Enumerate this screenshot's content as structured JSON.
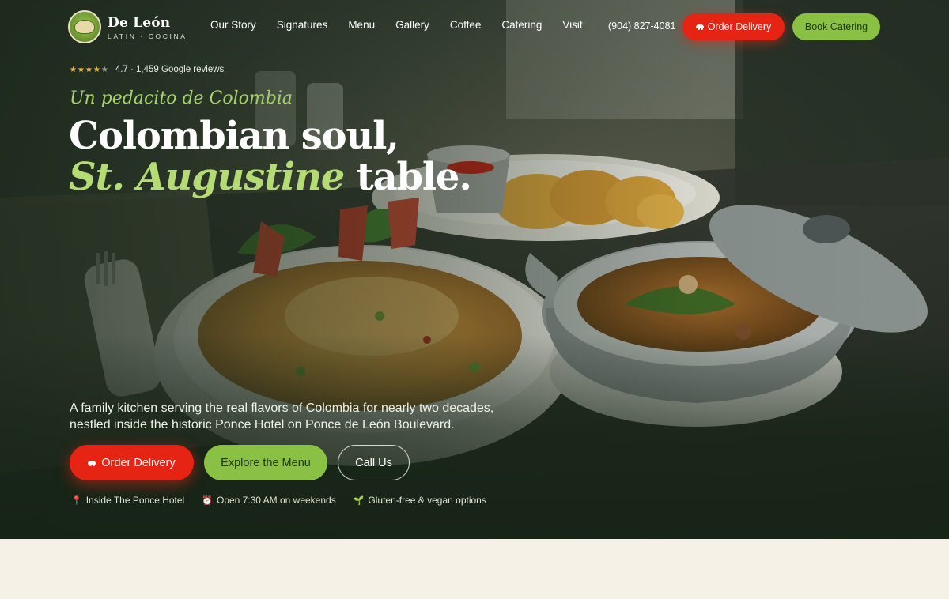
{
  "brand": {
    "name": "De León",
    "subtitle": "LATIN · COCINA"
  },
  "nav": {
    "links": [
      "Our Story",
      "Signatures",
      "Menu",
      "Gallery",
      "Coffee",
      "Catering",
      "Visit"
    ],
    "phone": "(904) 827-4081",
    "order_delivery": "Order Delivery",
    "book_catering": "Book Catering"
  },
  "hero": {
    "rating_text": "4.7 · 1,459 Google reviews",
    "stars_filled": "★★★★",
    "stars_partial": "★",
    "tagline": "Un pedacito de Colombia",
    "headline_line1": "Colombian soul,",
    "headline_accent": "St. Augustine",
    "headline_rest": " table.",
    "intro": "A family kitchen serving the real flavors of Colombia for nearly two decades, nestled inside the historic Ponce Hotel on Ponce de León Boulevard.",
    "cta_delivery": "Order Delivery",
    "cta_menu": "Explore the Menu",
    "cta_call": "Call Us",
    "features": [
      {
        "icon": "pin-icon",
        "text": "Inside The Ponce Hotel"
      },
      {
        "icon": "alarm-clock-icon",
        "text": "Open 7:30 AM on weekends"
      },
      {
        "icon": "seedling-icon",
        "text": "Gluten-free & vegan options"
      }
    ]
  },
  "colors": {
    "accent_red": "#e62414",
    "accent_green": "#8ac043",
    "tagline_green": "#a8d36a",
    "cream": "#f6f1e6",
    "hero_dark": "#1a281a"
  }
}
